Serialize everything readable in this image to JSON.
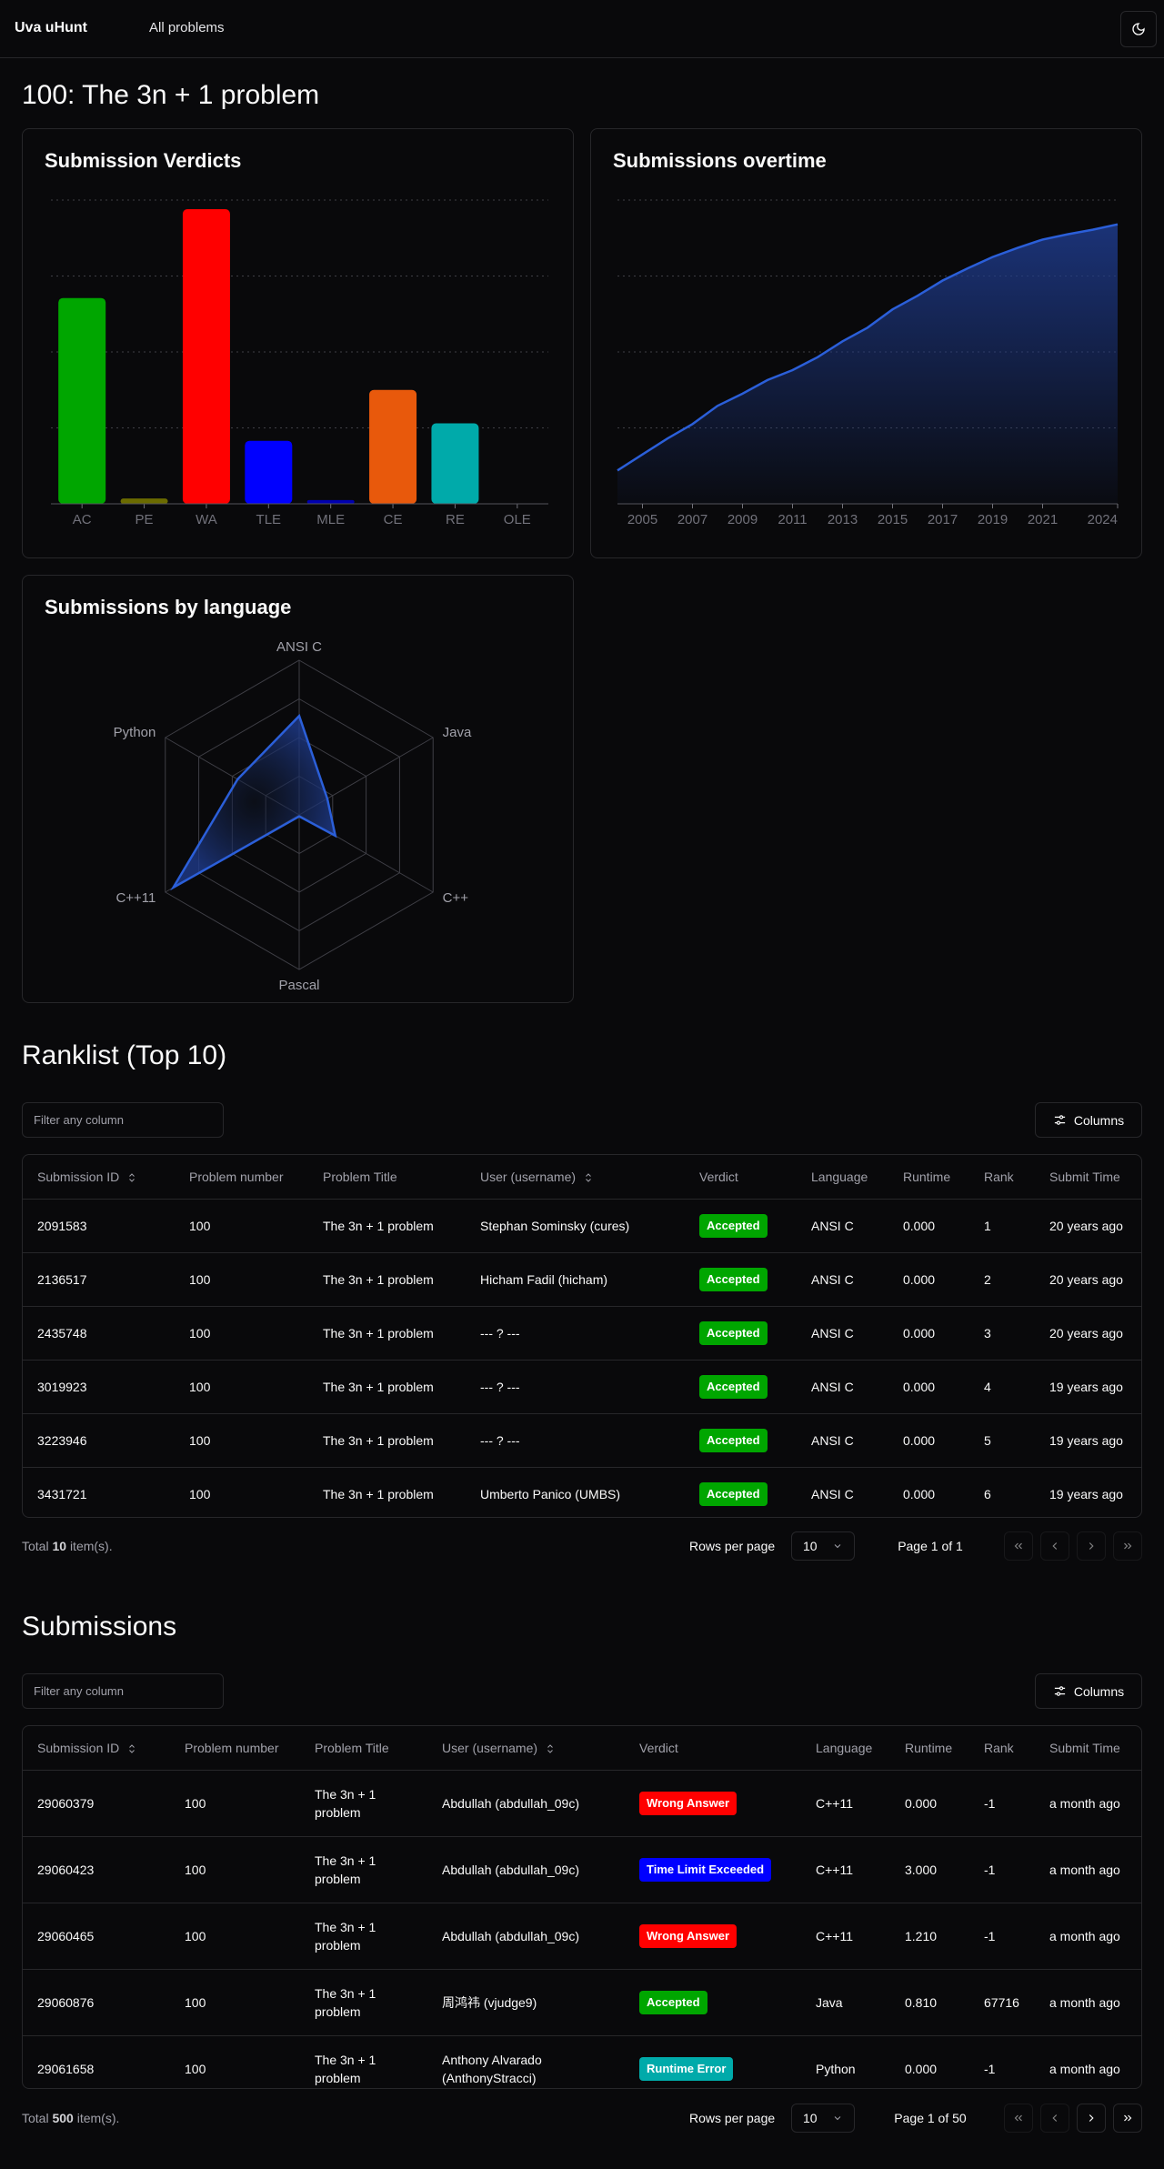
{
  "nav": {
    "brand": "Uva uHunt",
    "all_problems": "All problems",
    "theme_icon": "moon-icon"
  },
  "page_title": "100: The 3n + 1 problem",
  "colors": {
    "background": "#09090b",
    "border": "#27272a",
    "area": "#2b5fd9",
    "accepted": "#00a600",
    "wrong_answer": "#ff0000",
    "tle": "#0000ff",
    "runtime_error": "#00aaaa"
  },
  "chart_data": [
    {
      "type": "bar",
      "title": "Submission Verdicts",
      "categories": [
        "AC",
        "PE",
        "WA",
        "TLE",
        "MLE",
        "CE",
        "RE",
        "OLE"
      ],
      "values": [
        2.71,
        0.07,
        3.88,
        0.83,
        0.05,
        1.5,
        1.06,
        0
      ],
      "colors": [
        "#00a600",
        "#6b6b00",
        "#ff0000",
        "#0000ff",
        "#0000b0",
        "#e8590c",
        "#00aaaa",
        "#000066"
      ],
      "ylim": [
        0,
        4
      ],
      "grid": true
    },
    {
      "type": "area",
      "title": "Submissions overtime",
      "x": [
        2004,
        2005,
        2006,
        2007,
        2008,
        2009,
        2010,
        2011,
        2012,
        2013,
        2014,
        2015,
        2016,
        2017,
        2018,
        2019,
        2020,
        2021,
        2022,
        2023,
        2024
      ],
      "values": [
        0.44,
        0.65,
        0.86,
        1.05,
        1.29,
        1.45,
        1.63,
        1.76,
        1.93,
        2.14,
        2.32,
        2.56,
        2.74,
        2.94,
        3.1,
        3.25,
        3.37,
        3.48,
        3.55,
        3.61,
        3.68
      ],
      "tick_labels": [
        "2005",
        "2007",
        "2009",
        "2011",
        "2013",
        "2015",
        "2017",
        "2019",
        "2021",
        "2024"
      ],
      "xlim": [
        2004,
        2024
      ],
      "ylim": [
        0,
        4
      ],
      "grid": true
    },
    {
      "type": "radar",
      "title": "Submissions by language",
      "categories": [
        "ANSI C",
        "Java",
        "C++",
        "Pascal",
        "C++11",
        "Python"
      ],
      "values": [
        0.64,
        0.21,
        0.27,
        0.01,
        0.94,
        0.46
      ],
      "rmax": 1
    }
  ],
  "ranklist": {
    "title": "Ranklist (Top 10)",
    "filter_placeholder": "Filter any column",
    "columns_label": "Columns",
    "headers": [
      "Submission ID",
      "Problem number",
      "Problem Title",
      "User (username)",
      "Verdict",
      "Language",
      "Runtime",
      "Rank",
      "Submit Time"
    ],
    "rows": [
      [
        "2091583",
        "100",
        "The 3n + 1 problem",
        "Stephan Sominsky (cures)",
        "Accepted",
        "ANSI C",
        "0.000",
        "1",
        "20 years ago"
      ],
      [
        "2136517",
        "100",
        "The 3n + 1 problem",
        "Hicham Fadil (hicham)",
        "Accepted",
        "ANSI C",
        "0.000",
        "2",
        "20 years ago"
      ],
      [
        "2435748",
        "100",
        "The 3n + 1 problem",
        "--- ? ---",
        "Accepted",
        "ANSI C",
        "0.000",
        "3",
        "20 years ago"
      ],
      [
        "3019923",
        "100",
        "The 3n + 1 problem",
        "--- ? ---",
        "Accepted",
        "ANSI C",
        "0.000",
        "4",
        "19 years ago"
      ],
      [
        "3223946",
        "100",
        "The 3n + 1 problem",
        "--- ? ---",
        "Accepted",
        "ANSI C",
        "0.000",
        "5",
        "19 years ago"
      ],
      [
        "3431721",
        "100",
        "The 3n + 1 problem",
        "Umberto Panico (UMBS)",
        "Accepted",
        "ANSI C",
        "0.000",
        "6",
        "19 years ago"
      ]
    ],
    "total_prefix": "Total",
    "total_count": "10",
    "total_suffix": "item(s).",
    "rows_per_page_label": "Rows per page",
    "rows_per_page": "10",
    "page_info": "Page 1 of 1"
  },
  "submissions": {
    "title": "Submissions",
    "filter_placeholder": "Filter any column",
    "columns_label": "Columns",
    "headers": [
      "Submission ID",
      "Problem number",
      "Problem Title",
      "User (username)",
      "Verdict",
      "Language",
      "Runtime",
      "Rank",
      "Submit Time"
    ],
    "rows": [
      [
        "29060379",
        "100",
        "The 3n + 1 problem",
        "Abdullah (abdullah_09c)",
        "Wrong Answer",
        "C++11",
        "0.000",
        "-1",
        "a month ago"
      ],
      [
        "29060423",
        "100",
        "The 3n + 1 problem",
        "Abdullah (abdullah_09c)",
        "Time Limit Exceeded",
        "C++11",
        "3.000",
        "-1",
        "a month ago"
      ],
      [
        "29060465",
        "100",
        "The 3n + 1 problem",
        "Abdullah (abdullah_09c)",
        "Wrong Answer",
        "C++11",
        "1.210",
        "-1",
        "a month ago"
      ],
      [
        "29060876",
        "100",
        "The 3n + 1 problem",
        "周鸿祎 (vjudge9)",
        "Accepted",
        "Java",
        "0.810",
        "67716",
        "a month ago"
      ],
      [
        "29061658",
        "100",
        "The 3n + 1 problem",
        "Anthony Alvarado (AnthonyStracci)",
        "Runtime Error",
        "Python",
        "0.000",
        "-1",
        "a month ago"
      ]
    ],
    "total_prefix": "Total",
    "total_count": "500",
    "total_suffix": "item(s).",
    "rows_per_page_label": "Rows per page",
    "rows_per_page": "10",
    "page_info": "Page 1 of 50"
  }
}
